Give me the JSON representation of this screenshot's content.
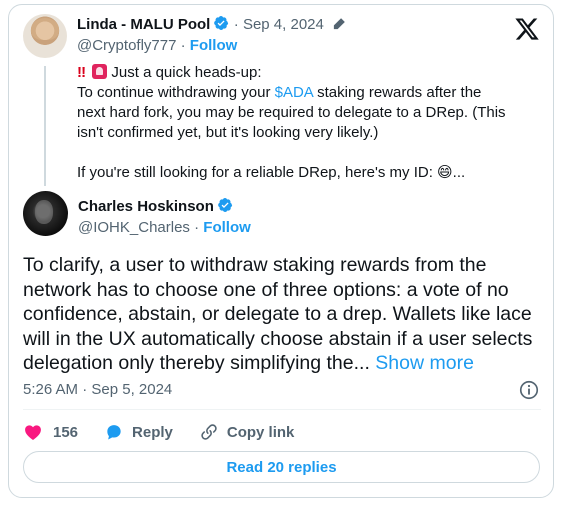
{
  "quoted": {
    "author_name": "Linda - MALU Pool",
    "date": "Sep 4, 2024",
    "handle": "@Cryptofly777",
    "follow_label": "Follow",
    "line1": "Just a quick heads-up:",
    "line2_pre": "To continue withdrawing your ",
    "line2_link": "$ADA",
    "line2_post": " staking rewards after the next hard fork, you may be required to delegate to a DRep. (This isn't confirmed yet, but it's looking very likely.)",
    "line3": "If you're still looking for a reliable DRep, here's my ID: 😄..."
  },
  "main": {
    "author_name": "Charles Hoskinson",
    "handle": "@IOHK_Charles",
    "follow_label": "Follow",
    "text": "To clarify, a user to withdraw staking rewards from the network has to choose one of three options: a vote of no confidence, abstain, or delegate to a drep. Wallets like lace will in the UX automatically choose abstain if a user selects delegation only thereby simplifying the...",
    "show_more": "Show more",
    "timestamp": "5:26 AM · Sep 5, 2024"
  },
  "actions": {
    "likes": "156",
    "reply_label": "Reply",
    "copy_label": "Copy link"
  },
  "read_replies_label": "Read 20 replies",
  "colors": {
    "accent": "#1d9bf0",
    "like": "#f91880",
    "text": "#0f1419",
    "muted": "#536471"
  }
}
